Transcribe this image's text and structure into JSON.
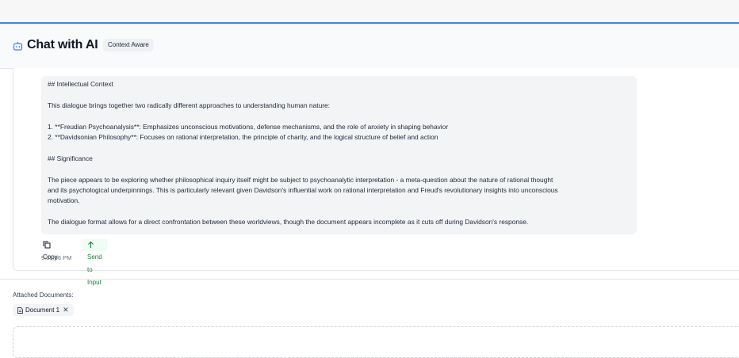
{
  "header": {
    "title": "Chat with AI",
    "badge": "Context Aware",
    "icon": "bot-icon"
  },
  "message": {
    "lines": [
      "## Intellectual Context",
      "This dialogue brings together two radically different approaches to understanding human nature:",
      "1. **Freudian Psychoanalysis**: Emphasizes unconscious motivations, defense mechanisms, and the role of anxiety in shaping behavior",
      "2. **Davidsonian Philosophy**: Focuses on rational interpretation, the principle of charity, and the logical structure of belief and action",
      "## Significance",
      "The piece appears to be exploring whether philosophical inquiry itself might be subject to psychoanalytic interpretation - a meta-question about the nature of rational thought",
      "and its psychological underpinnings. This is particularly relevant given Davidson's influential work on rational interpretation and Freud's revolutionary insights into unconscious",
      "motivation.",
      "The dialogue format allows for a direct confrontation between these worldviews, though the document appears incomplete as it cuts off during Davidson's response."
    ],
    "actions": {
      "copy_label": "Copy",
      "send_label": "Send to Input"
    },
    "timestamp": "9:38:06 PM"
  },
  "attachments": {
    "label": "Attached Documents:",
    "documents": [
      {
        "name": "Document 1"
      }
    ]
  },
  "colors": {
    "accent": "#3b82f6",
    "send_green": "#15803d",
    "bubble_bg": "#f3f4f6"
  }
}
